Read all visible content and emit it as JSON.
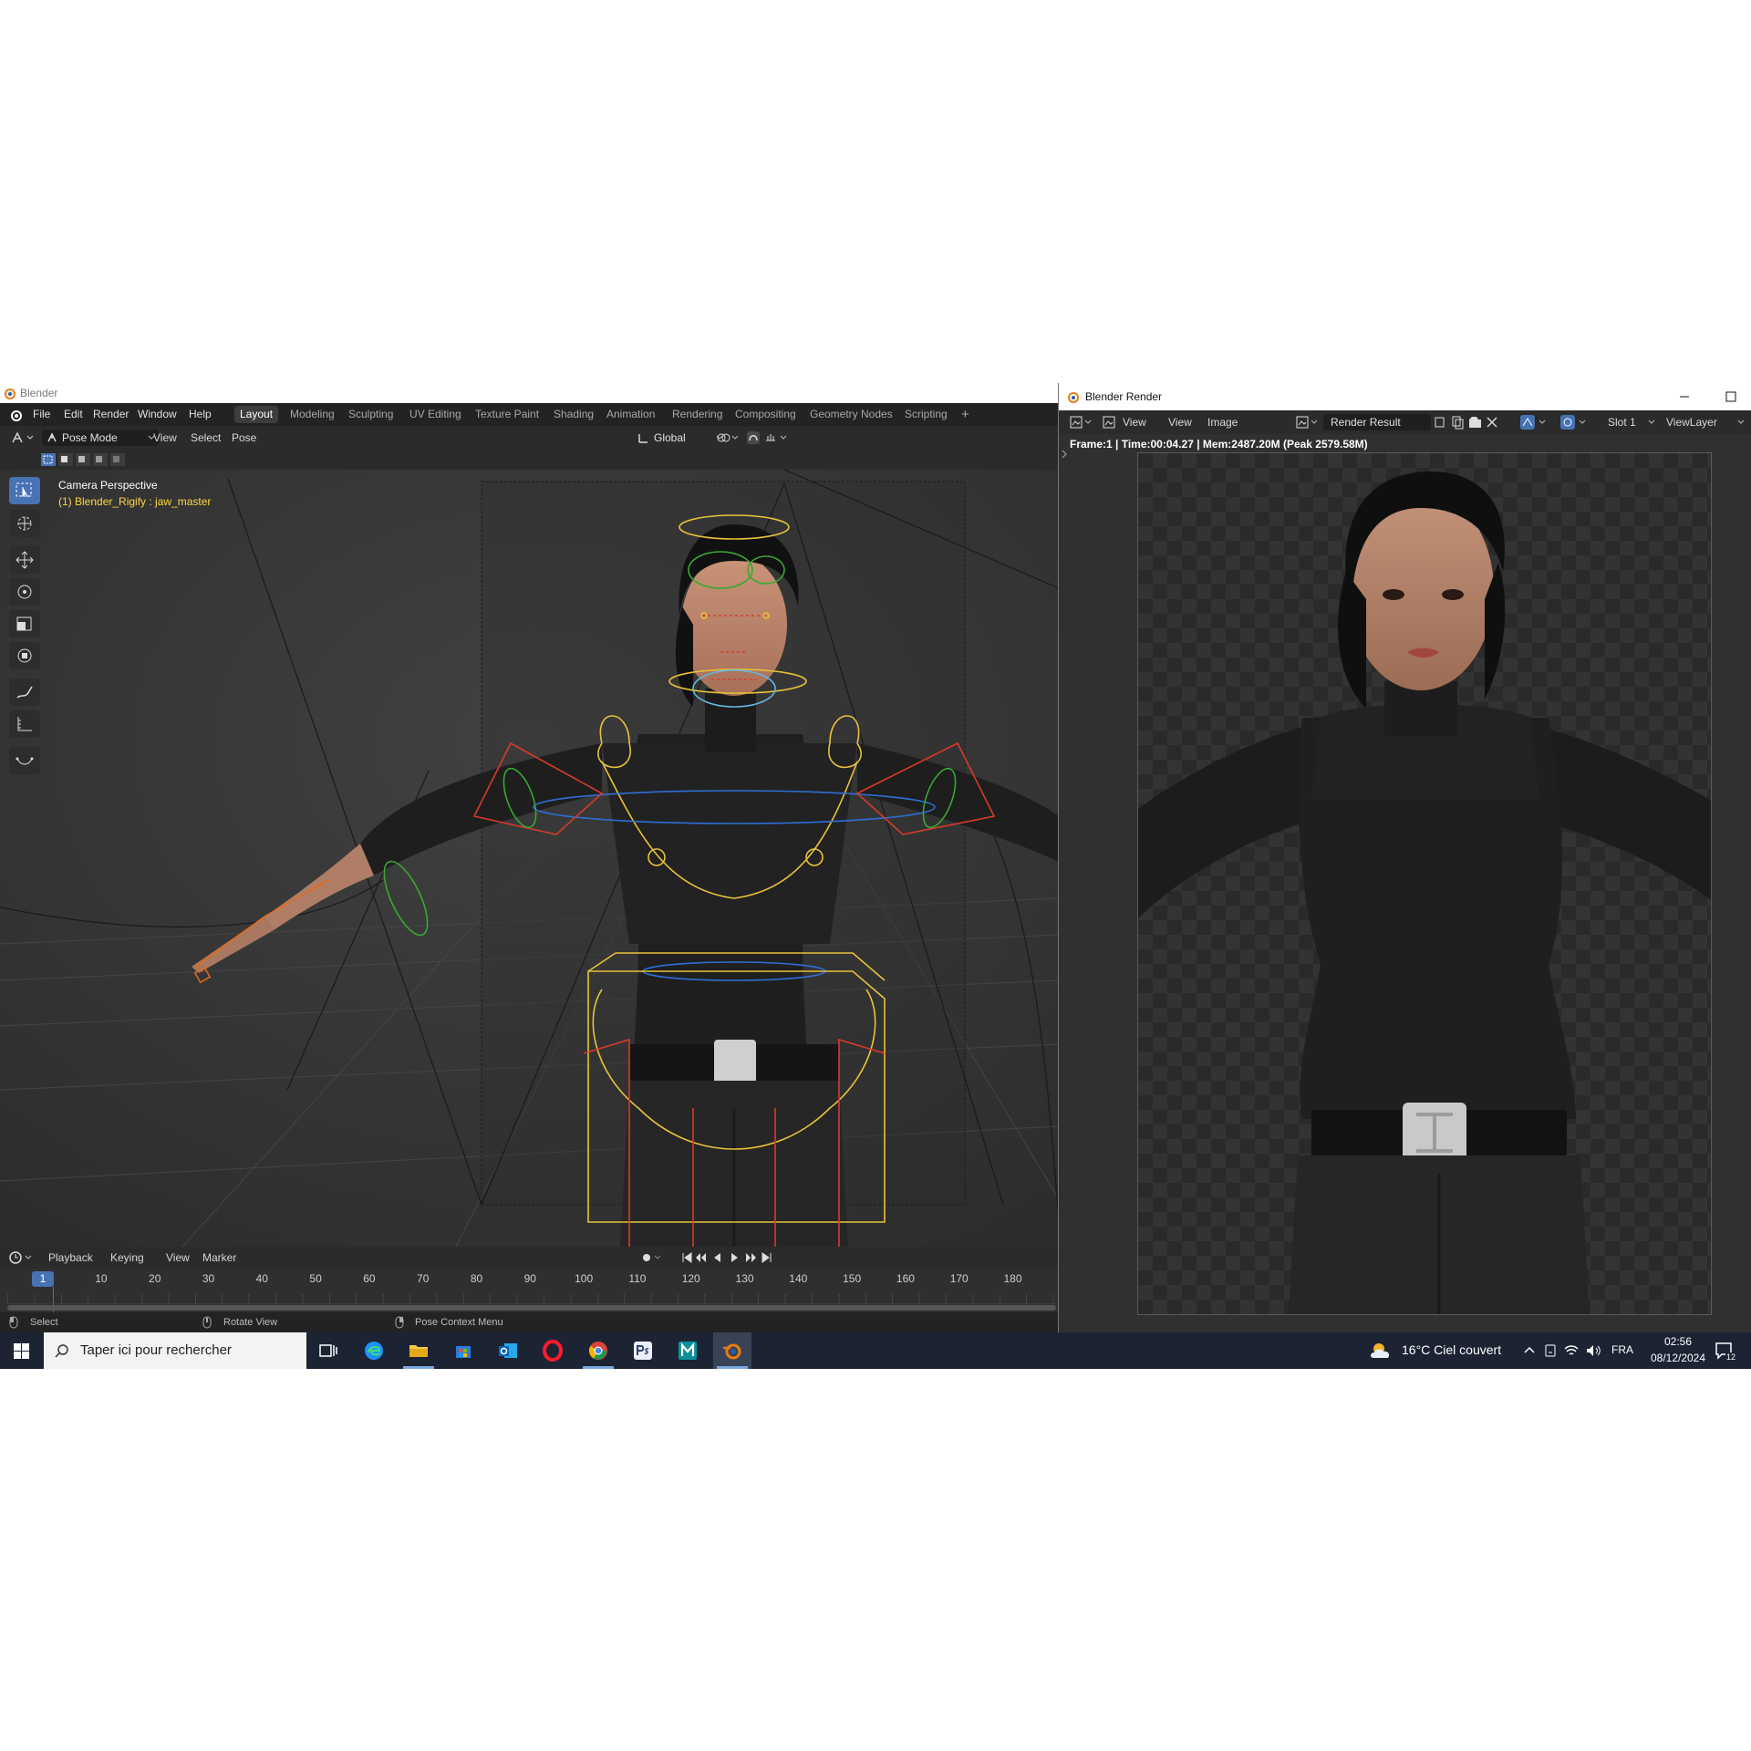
{
  "blender": {
    "window_title": "Blender",
    "menus": [
      "File",
      "Edit",
      "Render",
      "Window",
      "Help"
    ],
    "workspaces": [
      "Layout",
      "Modeling",
      "Sculpting",
      "UV Editing",
      "Texture Paint",
      "Shading",
      "Animation",
      "Rendering",
      "Compositing",
      "Geometry Nodes",
      "Scripting",
      "+"
    ],
    "active_workspace": "Layout",
    "header": {
      "mode": "Pose Mode",
      "view": "View",
      "select": "Select",
      "pose": "Pose",
      "orientation": "Global"
    },
    "viewport": {
      "camera_label": "Camera Perspective",
      "active_object": "(1) Blender_Rigify : jaw_master"
    },
    "timeline": {
      "menus": [
        "Playback",
        "Keying",
        "View",
        "Marker"
      ],
      "current_frame": "1",
      "frame_ticks": [
        "10",
        "20",
        "30",
        "40",
        "50",
        "60",
        "70",
        "80",
        "90",
        "100",
        "110",
        "120",
        "130",
        "140",
        "150",
        "160",
        "170",
        "180"
      ]
    },
    "statusbar": {
      "select": "Select",
      "rotate": "Rotate View",
      "context": "Pose Context Menu"
    }
  },
  "render_window": {
    "title": "Blender Render",
    "menus": [
      "View",
      "View",
      "Image"
    ],
    "image_name": "Render Result",
    "slot": "Slot 1",
    "view_layer": "ViewLayer",
    "info": "Frame:1 | Time:00:04.27 | Mem:2487.20M (Peak 2579.58M)"
  },
  "taskbar": {
    "search_placeholder": "Taper ici pour rechercher",
    "weather": "16°C  Ciel couvert",
    "language": "FRA",
    "time": "02:56",
    "date": "08/12/2024",
    "notification_count": "12"
  },
  "colors": {
    "accent": "#4772b3",
    "rig_yellow": "#e8c23a",
    "rig_red": "#d83a2a",
    "rig_green": "#38a832",
    "rig_blue": "#2d6fd6"
  }
}
